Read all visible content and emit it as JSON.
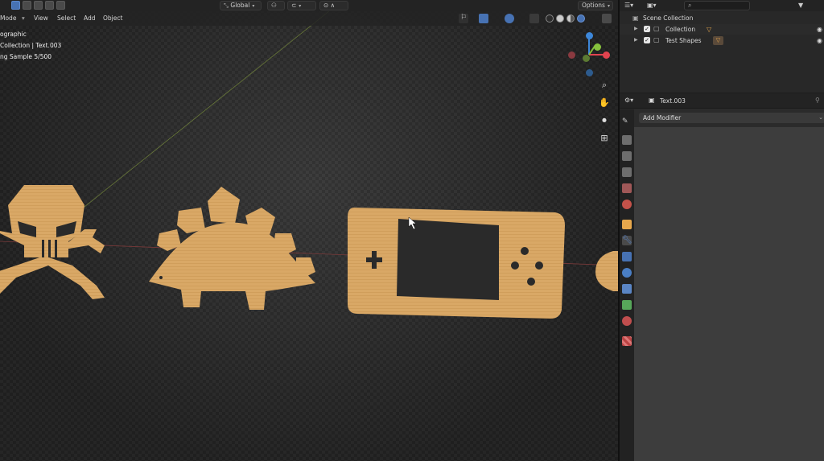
{
  "topbar": {
    "orientation": "Global",
    "options": "Options"
  },
  "header_menu": {
    "mode": "Mode",
    "view": "View",
    "select": "Select",
    "add": "Add",
    "object": "Object"
  },
  "viewport_overlay": {
    "line1": "ographic",
    "line2": "Collection | Text.003",
    "line3": "ng Sample 5/500"
  },
  "outliner": {
    "scene_collection": "Scene Collection",
    "rows": [
      {
        "label": "Collection",
        "checked": true
      },
      {
        "label": "Test Shapes",
        "checked": true
      }
    ]
  },
  "properties": {
    "object_name": "Text.003",
    "add_modifier": "Add Modifier",
    "active_tab": "modifier-tab"
  },
  "colors": {
    "accent": "#4772b3",
    "cardboard": "#d9a866",
    "axis_x": "#e2434f",
    "axis_y": "#86c13c",
    "axis_z": "#3d87d9"
  },
  "icons": [
    "cursor-icon",
    "gear-icon",
    "eye-icon",
    "hand-icon",
    "camera-icon",
    "grid-icon",
    "magnify-icon",
    "wrench-icon",
    "funnel-icon"
  ]
}
